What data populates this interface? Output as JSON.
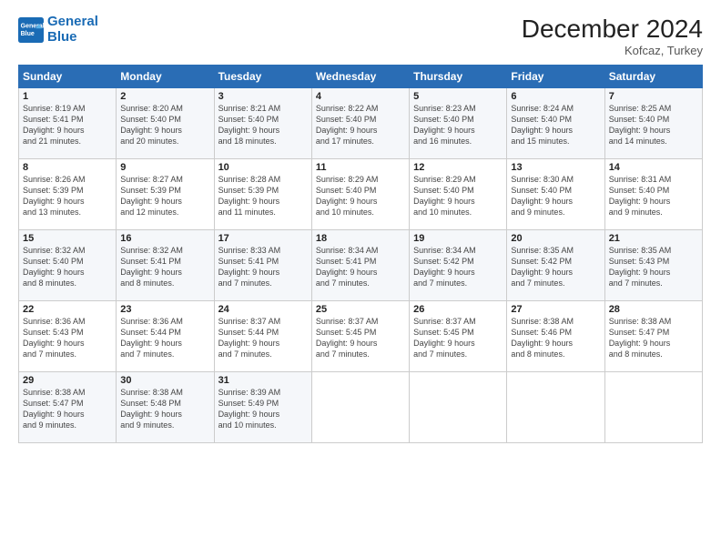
{
  "logo": {
    "line1": "General",
    "line2": "Blue"
  },
  "title": "December 2024",
  "location": "Kofcaz, Turkey",
  "days_header": [
    "Sunday",
    "Monday",
    "Tuesday",
    "Wednesday",
    "Thursday",
    "Friday",
    "Saturday"
  ],
  "weeks": [
    [
      {
        "day": "1",
        "info": "Sunrise: 8:19 AM\nSunset: 5:41 PM\nDaylight: 9 hours\nand 21 minutes."
      },
      {
        "day": "2",
        "info": "Sunrise: 8:20 AM\nSunset: 5:40 PM\nDaylight: 9 hours\nand 20 minutes."
      },
      {
        "day": "3",
        "info": "Sunrise: 8:21 AM\nSunset: 5:40 PM\nDaylight: 9 hours\nand 18 minutes."
      },
      {
        "day": "4",
        "info": "Sunrise: 8:22 AM\nSunset: 5:40 PM\nDaylight: 9 hours\nand 17 minutes."
      },
      {
        "day": "5",
        "info": "Sunrise: 8:23 AM\nSunset: 5:40 PM\nDaylight: 9 hours\nand 16 minutes."
      },
      {
        "day": "6",
        "info": "Sunrise: 8:24 AM\nSunset: 5:40 PM\nDaylight: 9 hours\nand 15 minutes."
      },
      {
        "day": "7",
        "info": "Sunrise: 8:25 AM\nSunset: 5:40 PM\nDaylight: 9 hours\nand 14 minutes."
      }
    ],
    [
      {
        "day": "8",
        "info": "Sunrise: 8:26 AM\nSunset: 5:39 PM\nDaylight: 9 hours\nand 13 minutes."
      },
      {
        "day": "9",
        "info": "Sunrise: 8:27 AM\nSunset: 5:39 PM\nDaylight: 9 hours\nand 12 minutes."
      },
      {
        "day": "10",
        "info": "Sunrise: 8:28 AM\nSunset: 5:39 PM\nDaylight: 9 hours\nand 11 minutes."
      },
      {
        "day": "11",
        "info": "Sunrise: 8:29 AM\nSunset: 5:40 PM\nDaylight: 9 hours\nand 10 minutes."
      },
      {
        "day": "12",
        "info": "Sunrise: 8:29 AM\nSunset: 5:40 PM\nDaylight: 9 hours\nand 10 minutes."
      },
      {
        "day": "13",
        "info": "Sunrise: 8:30 AM\nSunset: 5:40 PM\nDaylight: 9 hours\nand 9 minutes."
      },
      {
        "day": "14",
        "info": "Sunrise: 8:31 AM\nSunset: 5:40 PM\nDaylight: 9 hours\nand 9 minutes."
      }
    ],
    [
      {
        "day": "15",
        "info": "Sunrise: 8:32 AM\nSunset: 5:40 PM\nDaylight: 9 hours\nand 8 minutes."
      },
      {
        "day": "16",
        "info": "Sunrise: 8:32 AM\nSunset: 5:41 PM\nDaylight: 9 hours\nand 8 minutes."
      },
      {
        "day": "17",
        "info": "Sunrise: 8:33 AM\nSunset: 5:41 PM\nDaylight: 9 hours\nand 7 minutes."
      },
      {
        "day": "18",
        "info": "Sunrise: 8:34 AM\nSunset: 5:41 PM\nDaylight: 9 hours\nand 7 minutes."
      },
      {
        "day": "19",
        "info": "Sunrise: 8:34 AM\nSunset: 5:42 PM\nDaylight: 9 hours\nand 7 minutes."
      },
      {
        "day": "20",
        "info": "Sunrise: 8:35 AM\nSunset: 5:42 PM\nDaylight: 9 hours\nand 7 minutes."
      },
      {
        "day": "21",
        "info": "Sunrise: 8:35 AM\nSunset: 5:43 PM\nDaylight: 9 hours\nand 7 minutes."
      }
    ],
    [
      {
        "day": "22",
        "info": "Sunrise: 8:36 AM\nSunset: 5:43 PM\nDaylight: 9 hours\nand 7 minutes."
      },
      {
        "day": "23",
        "info": "Sunrise: 8:36 AM\nSunset: 5:44 PM\nDaylight: 9 hours\nand 7 minutes."
      },
      {
        "day": "24",
        "info": "Sunrise: 8:37 AM\nSunset: 5:44 PM\nDaylight: 9 hours\nand 7 minutes."
      },
      {
        "day": "25",
        "info": "Sunrise: 8:37 AM\nSunset: 5:45 PM\nDaylight: 9 hours\nand 7 minutes."
      },
      {
        "day": "26",
        "info": "Sunrise: 8:37 AM\nSunset: 5:45 PM\nDaylight: 9 hours\nand 7 minutes."
      },
      {
        "day": "27",
        "info": "Sunrise: 8:38 AM\nSunset: 5:46 PM\nDaylight: 9 hours\nand 8 minutes."
      },
      {
        "day": "28",
        "info": "Sunrise: 8:38 AM\nSunset: 5:47 PM\nDaylight: 9 hours\nand 8 minutes."
      }
    ],
    [
      {
        "day": "29",
        "info": "Sunrise: 8:38 AM\nSunset: 5:47 PM\nDaylight: 9 hours\nand 9 minutes."
      },
      {
        "day": "30",
        "info": "Sunrise: 8:38 AM\nSunset: 5:48 PM\nDaylight: 9 hours\nand 9 minutes."
      },
      {
        "day": "31",
        "info": "Sunrise: 8:39 AM\nSunset: 5:49 PM\nDaylight: 9 hours\nand 10 minutes."
      },
      null,
      null,
      null,
      null
    ]
  ]
}
